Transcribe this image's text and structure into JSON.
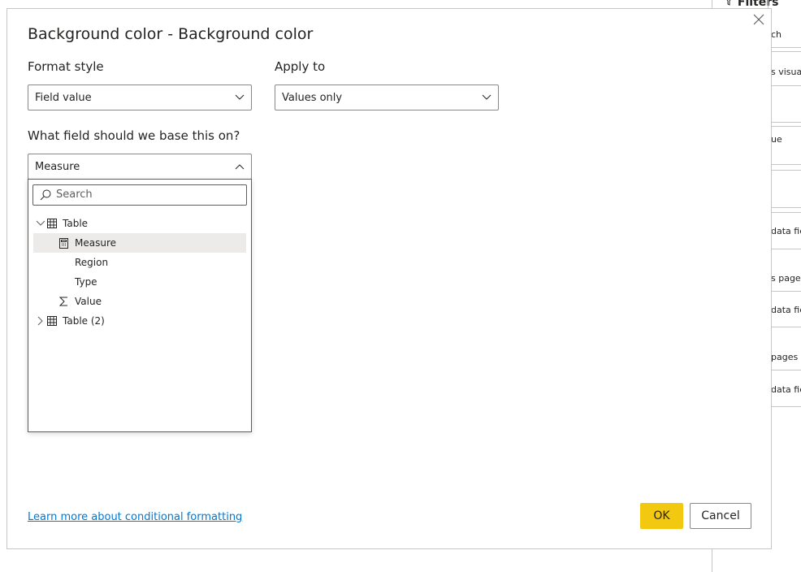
{
  "filters_pane": {
    "title": "Filters",
    "fragments": [
      "ch",
      "s visua",
      "ue",
      "data fie",
      "s page",
      "data fie",
      "pages",
      "data fie"
    ]
  },
  "dialog": {
    "title": "Background color - Background color",
    "format_style": {
      "label": "Format style",
      "value": "Field value"
    },
    "apply_to": {
      "label": "Apply to",
      "value": "Values only"
    },
    "field": {
      "label": "What field should we base this on?",
      "value": "Measure"
    },
    "dropdown": {
      "search_placeholder": "Search",
      "tree": [
        {
          "label": "Table",
          "icon": "table-icon",
          "expanded": true
        },
        {
          "label": "Measure",
          "icon": "calculator-icon",
          "selected": true
        },
        {
          "label": "Region",
          "icon": ""
        },
        {
          "label": "Type",
          "icon": ""
        },
        {
          "label": "Value",
          "icon": "sigma-icon"
        },
        {
          "label": "Table (2)",
          "icon": "table-icon",
          "expanded": false
        }
      ]
    },
    "learn_more_link": "Learn more about conditional formatting",
    "ok_label": "OK",
    "cancel_label": "Cancel"
  },
  "colors": {
    "accent": "#f2c811",
    "link": "#0078d4"
  }
}
